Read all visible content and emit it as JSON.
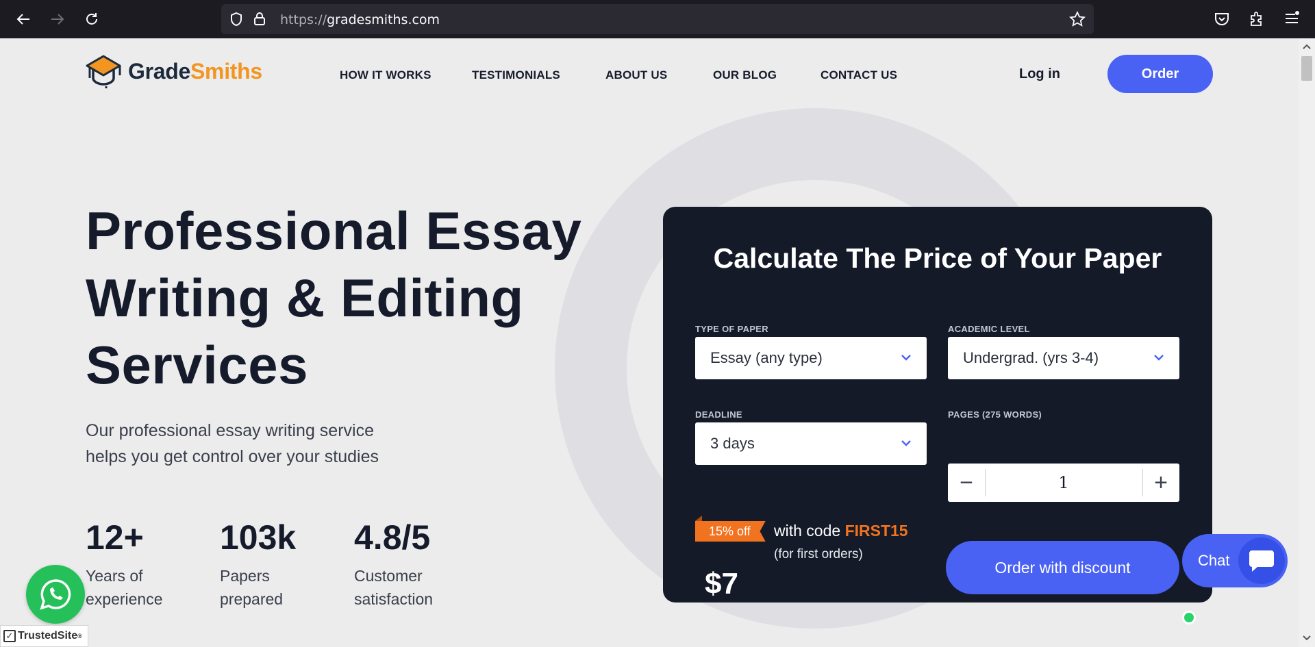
{
  "browser": {
    "url_scheme": "https://",
    "url_host": "gradesmiths.com"
  },
  "site": {
    "logo_part1": "Grade",
    "logo_part2": "Smiths",
    "logo_colors": {
      "dark": "#1c2a3c",
      "accent": "#f39521"
    },
    "nav": [
      "HOW IT WORKS",
      "TESTIMONIALS",
      "ABOUT US",
      "OUR BLOG",
      "CONTACT US"
    ],
    "login_label": "Log in",
    "order_label": "Order",
    "accent_color": "#4a62f4"
  },
  "hero": {
    "title_line1": "Professional Essay",
    "title_line2": "Writing & Editing",
    "title_line3": "Services",
    "subtitle_line1": "Our professional essay writing service",
    "subtitle_line2": "helps you get control over your studies",
    "stats": [
      {
        "value": "12+",
        "label_line1": "Years of",
        "label_line2": "experience"
      },
      {
        "value": "103k",
        "label_line1": "Papers",
        "label_line2": "prepared"
      },
      {
        "value": "4.8/5",
        "label_line1": "Customer",
        "label_line2": "satisfaction"
      }
    ]
  },
  "calculator": {
    "title": "Calculate The Price of Your Paper",
    "type_label": "TYPE OF PAPER",
    "type_value": "Essay (any type)",
    "level_label": "ACADEMIC LEVEL",
    "level_value": "Undergrad. (yrs 3-4)",
    "deadline_label": "DEADLINE",
    "deadline_value": "3 days",
    "pages_label": "PAGES (275 WORDS)",
    "pages_value": "1",
    "minus": "−",
    "plus": "+",
    "discount_badge": "15% off",
    "code_prefix": "with code ",
    "code": "FIRST15",
    "code_note": "(for first orders)",
    "price": "$7",
    "cta_label": "Order with discount"
  },
  "widgets": {
    "trusted_text": "TrustedSite",
    "trusted_mark": "®",
    "chat_label": "Chat"
  }
}
